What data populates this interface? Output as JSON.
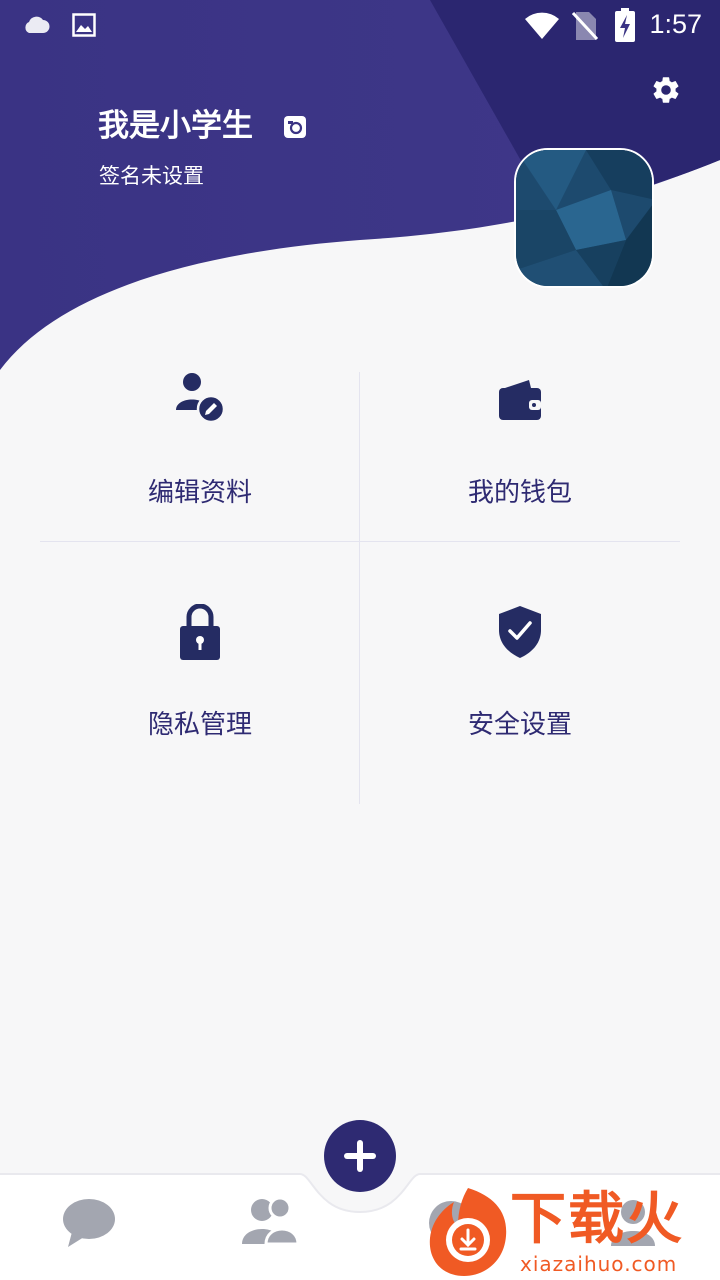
{
  "status_bar": {
    "time": "1:57"
  },
  "profile": {
    "name": "我是小学生",
    "signature": "签名未设置"
  },
  "menu": {
    "items": [
      {
        "label": "编辑资料",
        "icon": "edit-profile-icon"
      },
      {
        "label": "我的钱包",
        "icon": "wallet-icon"
      },
      {
        "label": "隐私管理",
        "icon": "lock-icon"
      },
      {
        "label": "安全设置",
        "icon": "shield-check-icon"
      }
    ]
  },
  "bottom_nav": {
    "items": [
      {
        "icon": "chat-bubble-icon"
      },
      {
        "icon": "contacts-icon"
      },
      {
        "icon": "discover-icon"
      },
      {
        "icon": "profile-icon"
      }
    ],
    "fab_icon": "plus-icon"
  },
  "watermark": {
    "brand": "下载火",
    "site": "xiazaihuo.com"
  },
  "colors": {
    "header_dark": "#2e2a72",
    "header_mid": "#3c3585",
    "icon": "#252c63",
    "label": "#2e2a72",
    "nav_icon": "#a3a6b0",
    "watermark": "#f05a24"
  }
}
